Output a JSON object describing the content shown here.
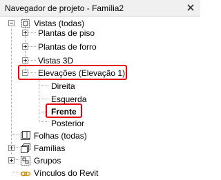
{
  "panel": {
    "title": "Navegador de projeto - Família2",
    "close_symbol": "×"
  },
  "tree": {
    "vistas": {
      "label": "Vistas (todas)",
      "icon": "views-icon"
    },
    "plantas_piso": {
      "label": "Plantas de piso"
    },
    "plantas_forro": {
      "label": "Plantas de forro"
    },
    "vistas_3d": {
      "label": "Vistas 3D"
    },
    "elevacoes": {
      "label": "Elevações (Elevação 1)"
    },
    "direita": {
      "label": "Direita"
    },
    "esquerda": {
      "label": "Esquerda"
    },
    "frente": {
      "label": "Frente"
    },
    "posterior": {
      "label": "Posterior"
    },
    "folhas": {
      "label": "Folhas (todas)",
      "icon": "sheets-icon"
    },
    "familias": {
      "label": "Famílias",
      "icon": "families-icon"
    },
    "grupos": {
      "label": "Grupos",
      "icon": "groups-icon"
    },
    "vinculos": {
      "label": "Vínculos do Revit",
      "icon": "revit-links-icon"
    }
  },
  "highlight_color": "#e3000f"
}
